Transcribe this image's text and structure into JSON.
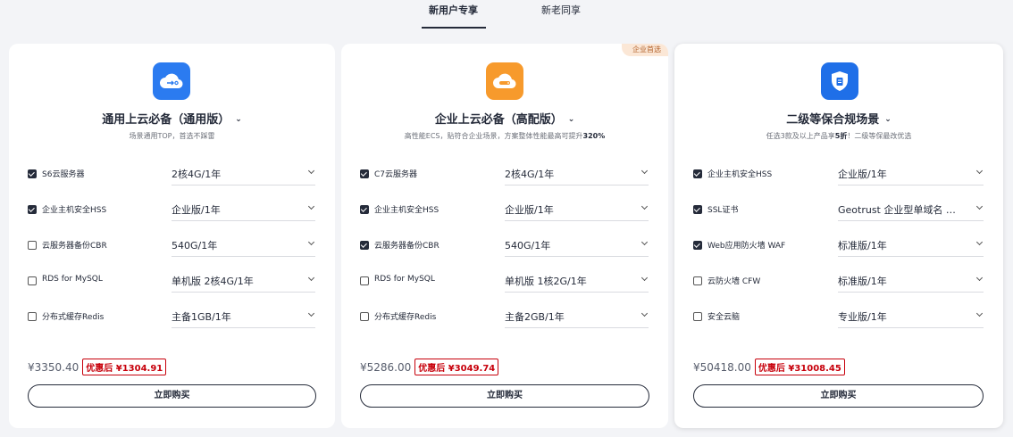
{
  "tabs": [
    {
      "label": "新用户专享",
      "active": true
    },
    {
      "label": "新老同享",
      "active": false
    }
  ],
  "cards": [
    {
      "icon": "cloud-server-icon",
      "title": "通用上云必备（通用版）",
      "subtitle_pre": "场景通用TOP，首选不踩雷",
      "subtitle_bold": "",
      "items": [
        {
          "label": "S6云服务器",
          "checked": true,
          "value": "2核4G/1年"
        },
        {
          "label": "企业主机安全HSS",
          "checked": true,
          "value": "企业版/1年"
        },
        {
          "label": "云服务器备份CBR",
          "checked": false,
          "value": "540G/1年"
        },
        {
          "label": "RDS for MySQL",
          "checked": false,
          "value": "单机版 2核4G/1年"
        },
        {
          "label": "分布式缓存Redis",
          "checked": false,
          "value": "主备1GB/1年"
        }
      ],
      "original_price": "¥3350.40",
      "discount_price": "优惠后 ¥1304.91",
      "buy_label": "立即购买"
    },
    {
      "icon": "cloud-storage-icon",
      "badge": "企业首选",
      "title": "企业上云必备（高配版）",
      "subtitle_pre": "高性能ECS，贴符合企业场景，方案整体性能最高可提升",
      "subtitle_bold": "320%",
      "items": [
        {
          "label": "C7云服务器",
          "checked": true,
          "value": "2核4G/1年"
        },
        {
          "label": "企业主机安全HSS",
          "checked": true,
          "value": "企业版/1年"
        },
        {
          "label": "云服务器备份CBR",
          "checked": true,
          "value": "540G/1年"
        },
        {
          "label": "RDS for MySQL",
          "checked": false,
          "value": "单机版 1核2G/1年"
        },
        {
          "label": "分布式缓存Redis",
          "checked": false,
          "value": "主备2GB/1年"
        }
      ],
      "original_price": "¥5286.00",
      "discount_price": "优惠后 ¥3049.74",
      "buy_label": "立即购买"
    },
    {
      "icon": "security-shield-icon",
      "title": "二级等保合规场景",
      "subtitle_pre": "任选3款及以上产品享",
      "subtitle_bold": "5折",
      "subtitle_post": "！二级等保最改优选",
      "items": [
        {
          "label": "企业主机安全HSS",
          "checked": true,
          "value": "企业版/1年"
        },
        {
          "label": "SSL证书",
          "checked": true,
          "value": "Geotrust 企业型单域名 …"
        },
        {
          "label": "Web应用防火墙 WAF",
          "checked": true,
          "value": "标准版/1年"
        },
        {
          "label": "云防火墙 CFW",
          "checked": false,
          "value": "标准版/1年"
        },
        {
          "label": "安全云脑",
          "checked": false,
          "value": "专业版/1年"
        }
      ],
      "original_price": "¥50418.00",
      "discount_price": "优惠后 ¥31008.45",
      "buy_label": "立即购买"
    }
  ]
}
